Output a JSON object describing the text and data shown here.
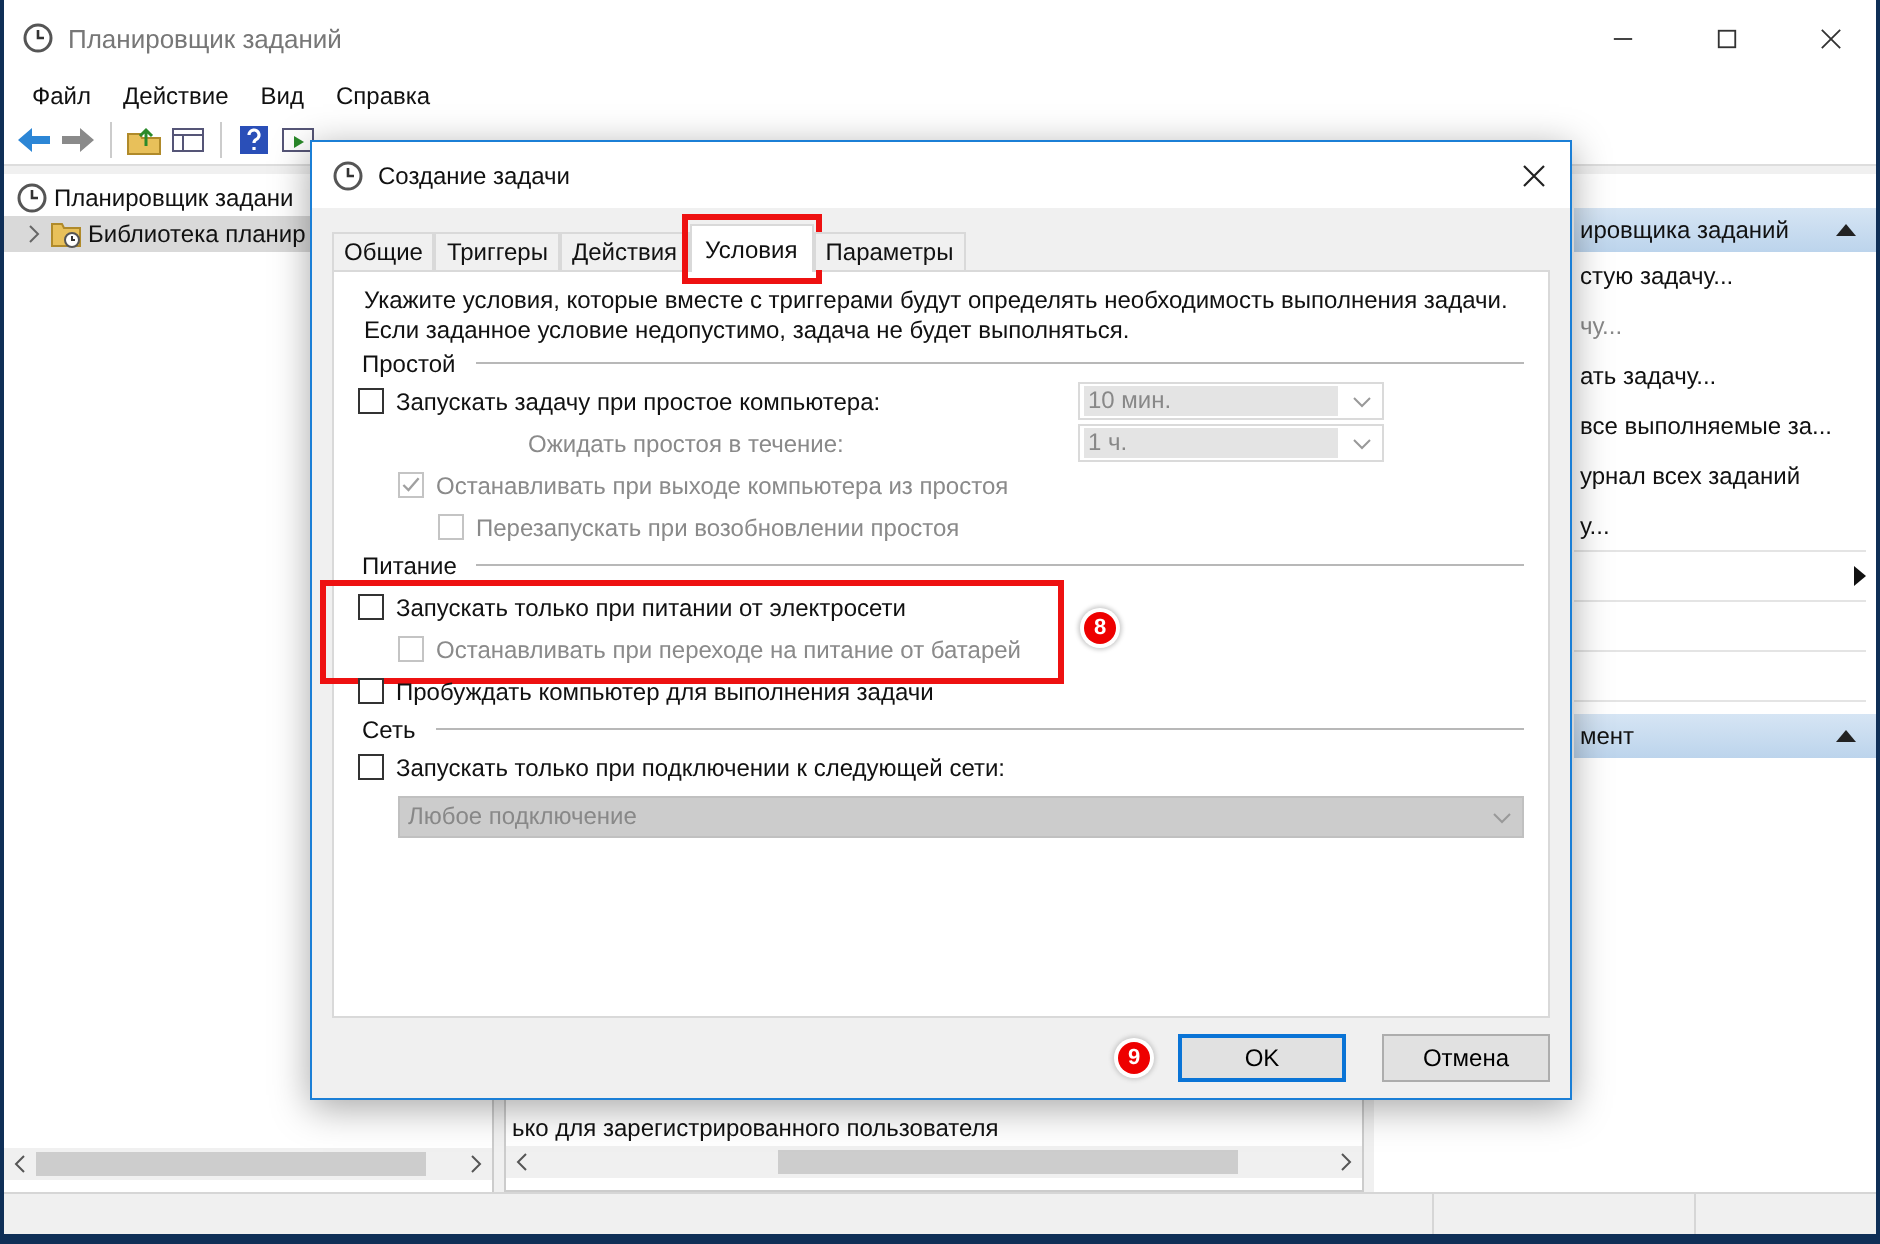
{
  "main_window": {
    "title": "Планировщик заданий",
    "menu": [
      "Файл",
      "Действие",
      "Вид",
      "Справка"
    ],
    "tree": [
      {
        "label": "Планировщик задани",
        "selected": false,
        "children": [
          {
            "label": "Библиотека планир",
            "selected": true,
            "expanded": false
          }
        ]
      }
    ],
    "center_pane": {
      "text": "ько для зарегистрированного пользователя"
    },
    "actions_panel": [
      {
        "header": "ировщика заданий",
        "items": [
          {
            "label": "стую задачу...",
            "disabled": false,
            "submenu": false
          },
          {
            "label": "чу...",
            "disabled": true,
            "submenu": false
          },
          {
            "label": "ать задачу...",
            "disabled": false,
            "submenu": false
          },
          {
            "label": "все выполняемые за...",
            "disabled": false,
            "submenu": false
          },
          {
            "label": "урнал всех заданий",
            "disabled": false,
            "submenu": false
          },
          {
            "label": "у...",
            "disabled": false,
            "submenu": false
          },
          {
            "disabled": false,
            "submenu": true
          }
        ]
      },
      {
        "header": "мент"
      }
    ]
  },
  "dialog": {
    "title": "Создание задачи",
    "tabs": [
      {
        "label": "Общие",
        "selected": false,
        "highlighted": false
      },
      {
        "label": "Триггеры",
        "selected": false,
        "highlighted": false
      },
      {
        "label": "Действия",
        "selected": false,
        "highlighted": false
      },
      {
        "label": "Условия",
        "selected": true,
        "highlighted": true
      },
      {
        "label": "Параметры",
        "selected": false,
        "highlighted": false
      }
    ],
    "intro": [
      "Укажите условия, которые вместе с триггерами будут определять необходимость выполнения задачи.",
      "Если заданное условие недопустимо, задача не будет выполняться."
    ],
    "sections": [
      {
        "title": "Простой",
        "rows": [
          {
            "kind": "checkbox",
            "label": "Запускать задачу при простое компьютера:",
            "checked": false,
            "disabled": false,
            "highlighted": false,
            "value": "10 мин.",
            "children": [
              {
                "kind": "label",
                "label": "Ожидать простоя в течение:",
                "disabled": true,
                "value": "1 ч."
              },
              {
                "kind": "checkbox",
                "label": "Останавливать при выходе компьютера из простоя",
                "checked": true,
                "disabled": true,
                "children": [
                  {
                    "kind": "checkbox",
                    "label": "Перезапускать при возобновлении простоя",
                    "checked": false,
                    "disabled": true
                  }
                ]
              }
            ]
          }
        ]
      },
      {
        "title": "Питание",
        "rows": [
          {
            "kind": "checkbox",
            "label": "Запускать только при питании от электросети",
            "checked": false,
            "disabled": false,
            "highlighted": true,
            "badge": "8",
            "children": [
              {
                "kind": "checkbox",
                "label": "Останавливать при переходе на питание от батарей",
                "checked": false,
                "disabled": true
              }
            ]
          },
          {
            "kind": "checkbox",
            "label": "Пробуждать компьютер для выполнения задачи",
            "checked": false,
            "disabled": false,
            "highlighted": false
          }
        ]
      },
      {
        "title": "Сеть",
        "rows": [
          {
            "kind": "checkbox",
            "label": "Запускать только при подключении к следующей сети:",
            "checked": false,
            "disabled": false,
            "highlighted": false,
            "children": [
              {
                "kind": "dropdown",
                "value": "Любое подключение",
                "disabled": true
              }
            ]
          }
        ]
      }
    ],
    "buttons": [
      {
        "label": "OK",
        "default": true,
        "badge": "9"
      },
      {
        "label": "Отмена",
        "default": false
      }
    ]
  }
}
